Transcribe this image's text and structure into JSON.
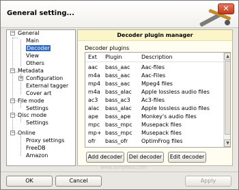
{
  "window": {
    "title": "General setting..."
  },
  "tree": {
    "items": [
      {
        "label": "General"
      },
      {
        "label": "Main"
      },
      {
        "label": "Decoder"
      },
      {
        "label": "View"
      },
      {
        "label": "Others"
      },
      {
        "label": "Metadata"
      },
      {
        "label": "Configuration"
      },
      {
        "label": "External tagger"
      },
      {
        "label": "Cover art"
      },
      {
        "label": "File mode"
      },
      {
        "label": "Settings"
      },
      {
        "label": "Disc mode"
      },
      {
        "label": "Settings"
      },
      {
        "label": "Online"
      },
      {
        "label": "Proxy settings"
      },
      {
        "label": "FreeDB"
      },
      {
        "label": "Amazon"
      }
    ]
  },
  "panel": {
    "header": "Decoder plugin manager",
    "group_label": "Decoder plugins",
    "columns": [
      "Ext",
      "Plugin",
      "Description"
    ],
    "rows": [
      [
        "aac",
        "bass_aac",
        "Aac-files"
      ],
      [
        "m4a",
        "bass_aac",
        "Aac-Files"
      ],
      [
        "mp4",
        "bass_aac",
        "Mpeg4 files"
      ],
      [
        "m4a",
        "bass_alac",
        "Apple lossless audio files"
      ],
      [
        "ac3",
        "bass_ac3",
        "Ac3-files"
      ],
      [
        "alac",
        "bass_alac",
        "Apple lossless audio files"
      ],
      [
        "ape",
        "bass_ape",
        "Monkey's audio files"
      ],
      [
        "mpc",
        "bass_mpc",
        "Musepack files"
      ],
      [
        "mp+",
        "bass_mpc",
        "Musepack files"
      ],
      [
        "ofr",
        "bass_ofr",
        "OptimFrog files"
      ]
    ],
    "buttons": {
      "add": "Add decoder",
      "del": "Del decoder",
      "edit": "Edit decoder"
    }
  },
  "footer": {
    "ok": "OK",
    "cancel": "Cancel",
    "apply": "Apply"
  },
  "watermark": "www.softpedia.com"
}
